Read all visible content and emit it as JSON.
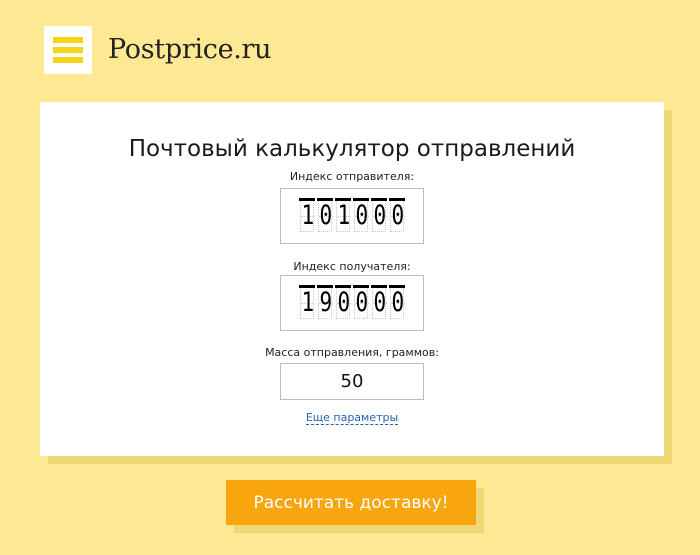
{
  "header": {
    "brand": "Postprice.ru",
    "logo_icon": "stamp-menu-icon"
  },
  "form": {
    "title": "Почтовый калькулятор отправлений",
    "sender_index": {
      "label": "Индекс отправителя:",
      "digits": [
        "1",
        "0",
        "1",
        "0",
        "0",
        "0"
      ]
    },
    "recipient_index": {
      "label": "Индекс получателя:",
      "digits": [
        "1",
        "9",
        "0",
        "0",
        "0",
        "0"
      ]
    },
    "mass": {
      "label": "Масса отправления, граммов:",
      "value": "50"
    },
    "more_params": "Еще параметры"
  },
  "actions": {
    "calculate_label": "Рассчитать доставку!"
  },
  "colors": {
    "background": "#fde993",
    "accent": "#f8a50e",
    "logo_bar": "#f7d417",
    "link": "#2463b5"
  }
}
